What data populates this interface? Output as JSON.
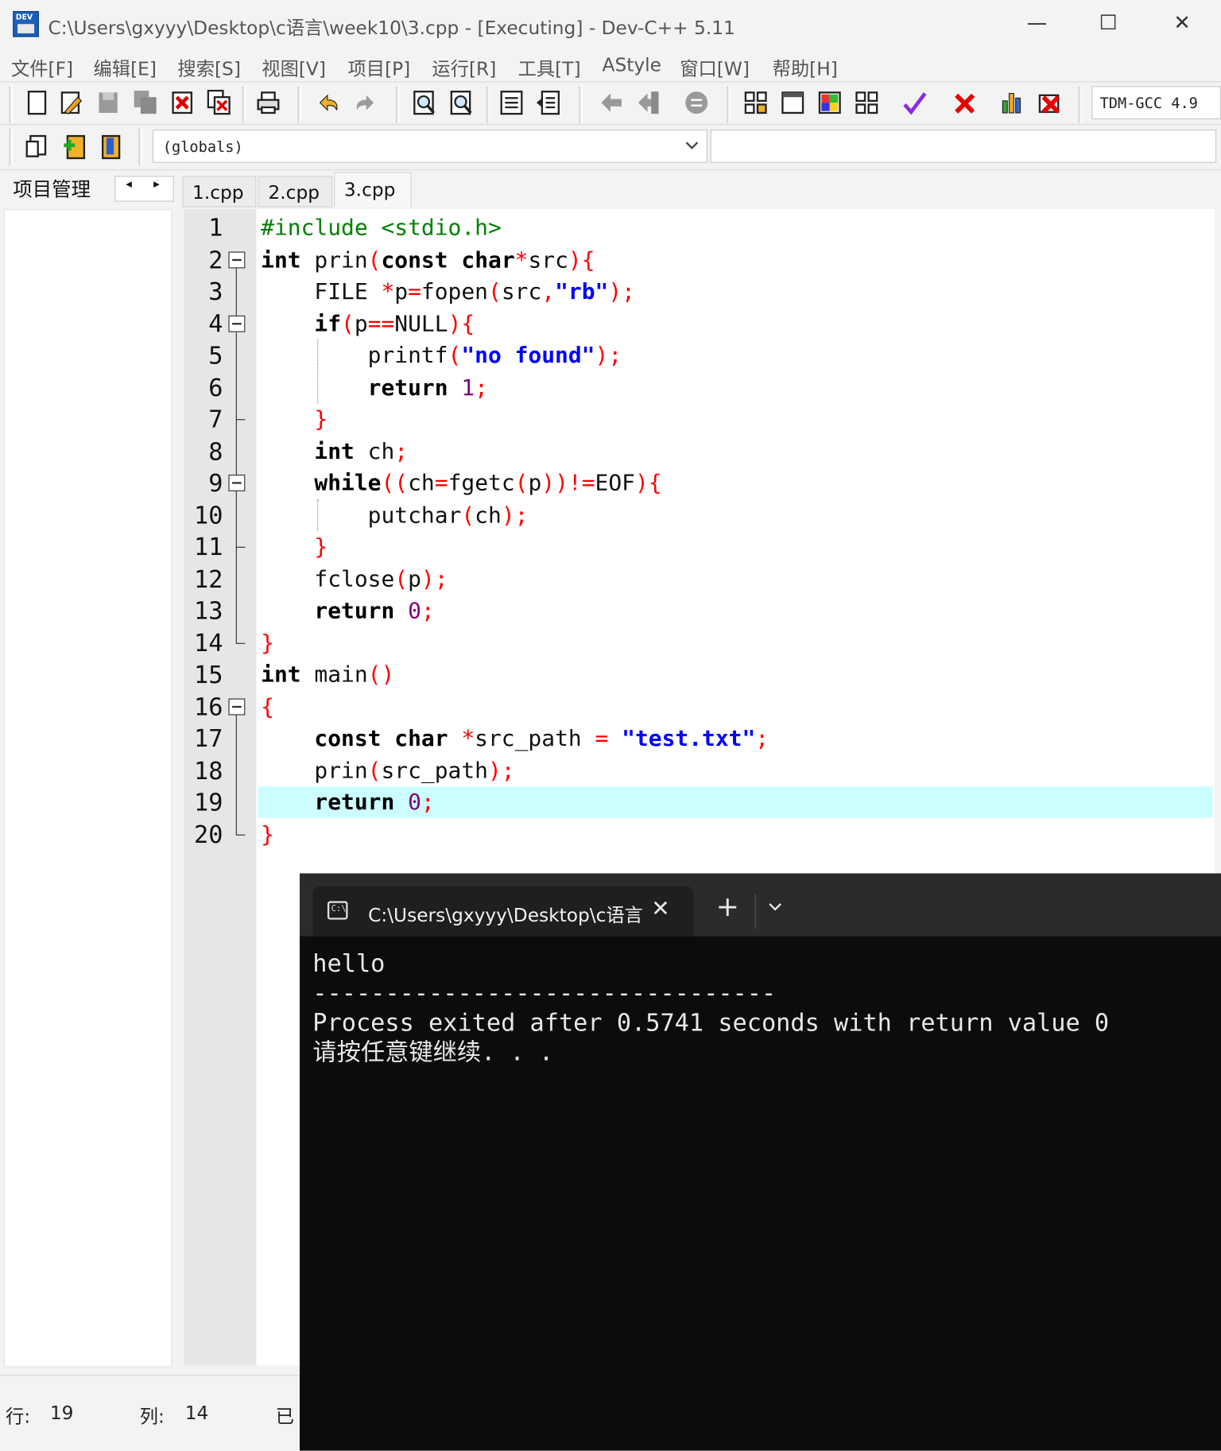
{
  "window": {
    "title": "C:\\Users\\gxyyy\\Desktop\\c语言\\week10\\3.cpp - [Executing] - Dev-C++ 5.11",
    "app_icon_label": "DEV",
    "minimize": "—",
    "maximize": "☐",
    "close": "✕"
  },
  "menu": [
    "文件[F]",
    "编辑[E]",
    "搜索[S]",
    "视图[V]",
    "项目[P]",
    "运行[R]",
    "工具[T]",
    "AStyle",
    "窗口[W]",
    "帮助[H]"
  ],
  "toolbar": {
    "compiler_select": "TDM-GCC 4.9",
    "icons": [
      "new-file-icon",
      "open-file-icon",
      "save-icon",
      "save-all-icon",
      "close-file-icon",
      "close-all-icon",
      "print-icon",
      "undo-icon",
      "redo-icon",
      "find-icon",
      "replace-icon",
      "indent-icon",
      "unindent-icon",
      "goto-back-icon",
      "goto-forward-icon",
      "toggle-bookmark-icon",
      "new-project-icon",
      "new-class-icon",
      "project-options-icon",
      "layout-icon",
      "check-syntax-icon",
      "abort-icon",
      "chart-icon",
      "delete-project-icon"
    ]
  },
  "toolbar2": {
    "icons": [
      "insert-icon",
      "add-to-project-icon",
      "book-icon"
    ],
    "scope_select": "(globals)"
  },
  "project_panel": {
    "label": "项目管理",
    "prev": "◂",
    "next": "▸"
  },
  "tabs": [
    "1.cpp",
    "2.cpp",
    "3.cpp"
  ],
  "active_tab": "3.cpp",
  "editor": {
    "current_line": 19,
    "lines": [
      [
        {
          "t": "#include <stdio.h>",
          "c": "pp"
        }
      ],
      [
        {
          "t": "int",
          "c": "kw"
        },
        {
          "t": " prin"
        },
        {
          "t": "(",
          "c": "sym"
        },
        {
          "t": "const",
          "c": "kw"
        },
        {
          "t": " "
        },
        {
          "t": "char",
          "c": "kw"
        },
        {
          "t": "*",
          "c": "sym"
        },
        {
          "t": "src"
        },
        {
          "t": "){",
          "c": "sym"
        }
      ],
      [
        {
          "t": "    FILE "
        },
        {
          "t": "*",
          "c": "sym"
        },
        {
          "t": "p"
        },
        {
          "t": "=",
          "c": "sym"
        },
        {
          "t": "fopen"
        },
        {
          "t": "(",
          "c": "sym"
        },
        {
          "t": "src"
        },
        {
          "t": ",",
          "c": "sym"
        },
        {
          "t": "\"rb\"",
          "c": "str"
        },
        {
          "t": ");",
          "c": "sym"
        }
      ],
      [
        {
          "t": "    "
        },
        {
          "t": "if",
          "c": "kw"
        },
        {
          "t": "(",
          "c": "sym"
        },
        {
          "t": "p"
        },
        {
          "t": "==",
          "c": "sym"
        },
        {
          "t": "NULL"
        },
        {
          "t": "){",
          "c": "sym"
        }
      ],
      [
        {
          "t": "        printf"
        },
        {
          "t": "(",
          "c": "sym"
        },
        {
          "t": "\"no found\"",
          "c": "str"
        },
        {
          "t": ");",
          "c": "sym"
        }
      ],
      [
        {
          "t": "        "
        },
        {
          "t": "return",
          "c": "kw"
        },
        {
          "t": " "
        },
        {
          "t": "1",
          "c": "num"
        },
        {
          "t": ";",
          "c": "sym"
        }
      ],
      [
        {
          "t": "    "
        },
        {
          "t": "}",
          "c": "sym"
        }
      ],
      [
        {
          "t": "    "
        },
        {
          "t": "int",
          "c": "kw"
        },
        {
          "t": " ch"
        },
        {
          "t": ";",
          "c": "sym"
        }
      ],
      [
        {
          "t": "    "
        },
        {
          "t": "while",
          "c": "kw"
        },
        {
          "t": "((",
          "c": "sym"
        },
        {
          "t": "ch"
        },
        {
          "t": "=",
          "c": "sym"
        },
        {
          "t": "fgetc"
        },
        {
          "t": "(",
          "c": "sym"
        },
        {
          "t": "p"
        },
        {
          "t": "))!=",
          "c": "sym"
        },
        {
          "t": "EOF"
        },
        {
          "t": "){",
          "c": "sym"
        }
      ],
      [
        {
          "t": "        putchar"
        },
        {
          "t": "(",
          "c": "sym"
        },
        {
          "t": "ch"
        },
        {
          "t": ");",
          "c": "sym"
        }
      ],
      [
        {
          "t": "    "
        },
        {
          "t": "}",
          "c": "sym"
        }
      ],
      [
        {
          "t": "    fclose"
        },
        {
          "t": "(",
          "c": "sym"
        },
        {
          "t": "p"
        },
        {
          "t": ");",
          "c": "sym"
        }
      ],
      [
        {
          "t": "    "
        },
        {
          "t": "return",
          "c": "kw"
        },
        {
          "t": " "
        },
        {
          "t": "0",
          "c": "num"
        },
        {
          "t": ";",
          "c": "sym"
        }
      ],
      [
        {
          "t": "}",
          "c": "sym"
        }
      ],
      [
        {
          "t": "int",
          "c": "kw"
        },
        {
          "t": " main"
        },
        {
          "t": "()",
          "c": "sym"
        }
      ],
      [
        {
          "t": "{",
          "c": "sym"
        }
      ],
      [
        {
          "t": "    "
        },
        {
          "t": "const",
          "c": "kw"
        },
        {
          "t": " "
        },
        {
          "t": "char",
          "c": "kw"
        },
        {
          "t": " "
        },
        {
          "t": "*",
          "c": "sym"
        },
        {
          "t": "src_path "
        },
        {
          "t": "=",
          "c": "sym"
        },
        {
          "t": " "
        },
        {
          "t": "\"test.txt\"",
          "c": "str"
        },
        {
          "t": ";",
          "c": "sym"
        }
      ],
      [
        {
          "t": "    prin"
        },
        {
          "t": "(",
          "c": "sym"
        },
        {
          "t": "src_path"
        },
        {
          "t": ");",
          "c": "sym"
        }
      ],
      [
        {
          "t": "    "
        },
        {
          "t": "return",
          "c": "kw"
        },
        {
          "t": " "
        },
        {
          "t": "0",
          "c": "num"
        },
        {
          "t": ";",
          "c": "sym"
        }
      ],
      [
        {
          "t": "}",
          "c": "sym"
        }
      ]
    ]
  },
  "status": {
    "line_label": "行:",
    "line_value": "19",
    "col_label": "列:",
    "col_value": "14",
    "extra": "已"
  },
  "console": {
    "tab_icon_label": "C:\\",
    "tab_title": "C:\\Users\\gxyyy\\Desktop\\c语言",
    "close": "✕",
    "new_tab": "+",
    "dropdown": "⌄",
    "lines": [
      "hello",
      "--------------------------------",
      "Process exited after 0.5741 seconds with return value 0",
      "请按任意键继续. . ."
    ]
  },
  "colors": {
    "keyword": "#000000",
    "preprocessor": "#008000",
    "string": "#0000ff",
    "number": "#800080",
    "symbol": "#ff0000",
    "current_line": "#ccfdff",
    "console_bg": "#0c0c0c"
  }
}
